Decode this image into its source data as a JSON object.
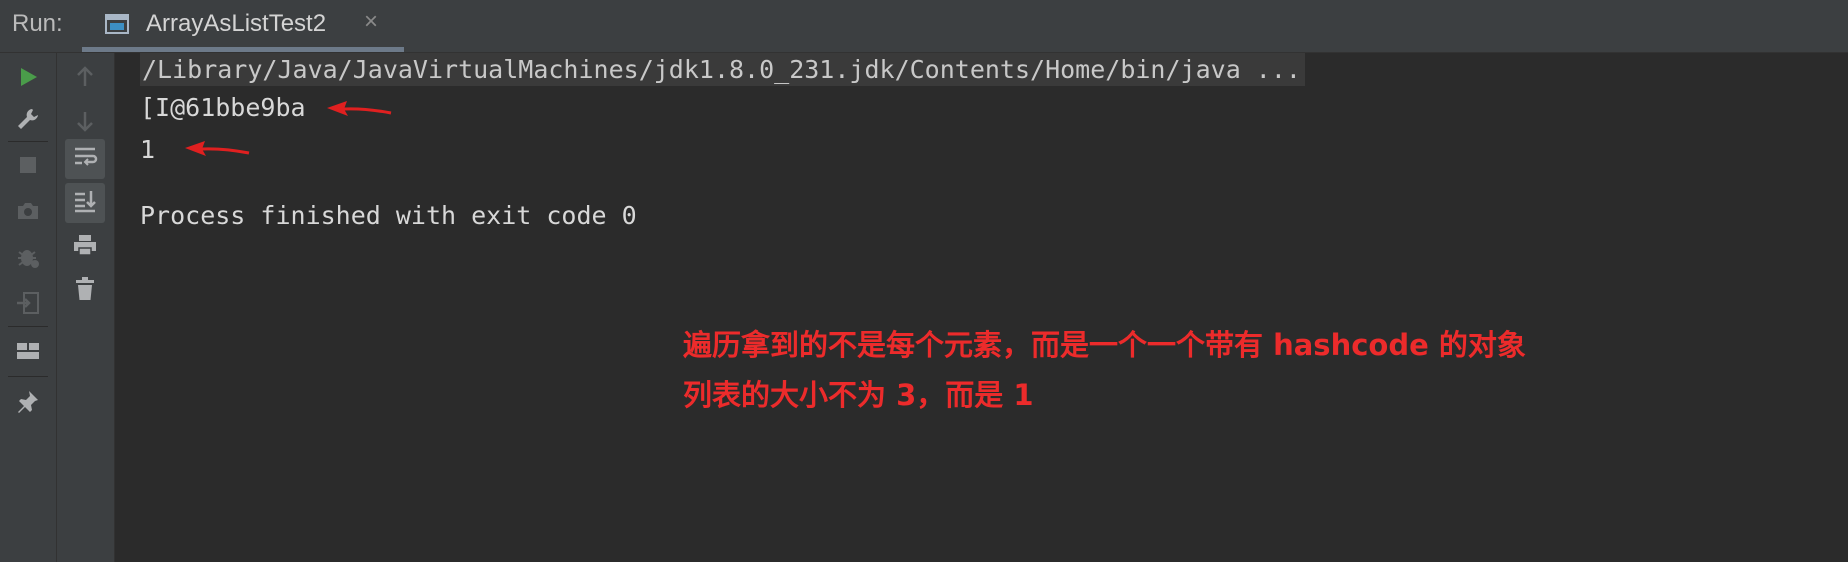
{
  "header": {
    "run_label": "Run:",
    "tab_title": "ArrayAsListTest2",
    "tab_close": "×"
  },
  "console": {
    "command": "/Library/Java/JavaVirtualMachines/jdk1.8.0_231.jdk/Contents/Home/bin/java ...",
    "output_line_1": "[I@61bbe9ba",
    "output_line_2": "1",
    "process_status": "Process finished with exit code 0"
  },
  "annotations": {
    "line_1": "遍历拿到的不是每个元素，而是一个一个带有 hashcode 的对象",
    "line_2": "列表的大小不为 3，而是 1",
    "color": "#ec2b2b"
  },
  "colors": {
    "background": "#2b2b2b",
    "toolbar": "#3c3f41",
    "run_icon": "#4a9c4a",
    "arrow": "#e02020"
  },
  "icons": {
    "left_toolbar": [
      "run-icon",
      "wrench-icon",
      "stop-icon",
      "camera-icon",
      "bug-settings-icon",
      "exit-icon",
      "layout-icon",
      "pin-icon"
    ],
    "right_toolbar": [
      "up-arrow-icon",
      "down-arrow-icon",
      "soft-wrap-icon",
      "scroll-to-end-icon",
      "print-icon",
      "trash-icon"
    ]
  }
}
